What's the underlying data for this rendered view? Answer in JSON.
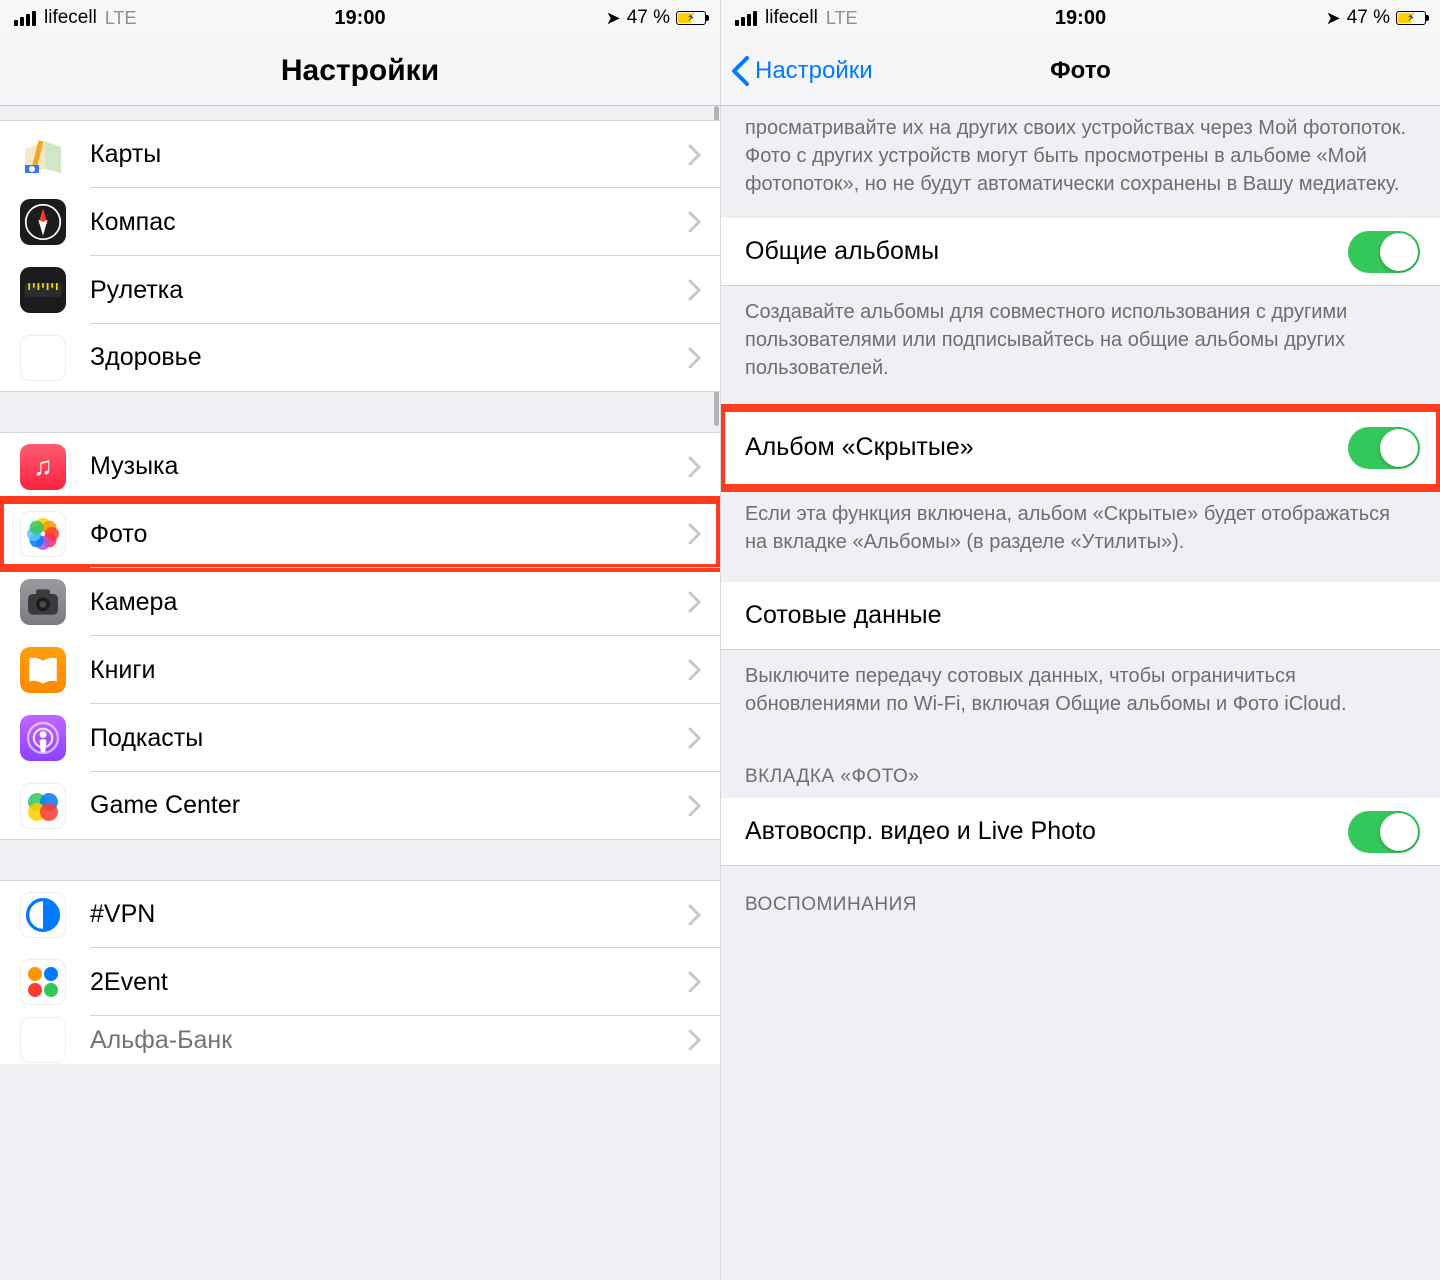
{
  "status": {
    "carrier": "lifecell",
    "network": "LTE",
    "time": "19:00",
    "battery_pct": "47 %",
    "location_glyph": "➤"
  },
  "left": {
    "title": "Настройки",
    "groups": [
      {
        "items": [
          {
            "key": "maps",
            "label": "Карты"
          },
          {
            "key": "compass",
            "label": "Компас"
          },
          {
            "key": "measure",
            "label": "Рулетка"
          },
          {
            "key": "health",
            "label": "Здоровье"
          }
        ]
      },
      {
        "items": [
          {
            "key": "music",
            "label": "Музыка"
          },
          {
            "key": "photos",
            "label": "Фото",
            "highlight": true
          },
          {
            "key": "camera",
            "label": "Камера"
          },
          {
            "key": "books",
            "label": "Книги"
          },
          {
            "key": "podcasts",
            "label": "Подкасты"
          },
          {
            "key": "gamecenter",
            "label": "Game Center"
          }
        ]
      },
      {
        "items": [
          {
            "key": "vpn",
            "label": "#VPN"
          },
          {
            "key": "2event",
            "label": "2Event"
          },
          {
            "key": "alpha",
            "label": "Альфа-Банк"
          }
        ]
      }
    ]
  },
  "right": {
    "back": "Настройки",
    "title": "Фото",
    "top_footer": "просматривайте их на других своих устройствах через Мой фотопоток. Фото с других устройств могут быть просмотрены в альбоме «Мой фотопоток», но не будут автоматически сохранены в Вашу медиатеку.",
    "shared_albums": {
      "label": "Общие альбомы",
      "on": true
    },
    "shared_footer": "Создавайте альбомы для совместного использования с другими пользователями или подписывайтесь на общие альбомы других пользователей.",
    "hidden": {
      "label": "Альбом «Скрытые»",
      "on": true,
      "highlight": true
    },
    "hidden_footer": "Если эта функция включена, альбом «Скрытые» будет отображаться на вкладке «Альбомы» (в разделе «Утилиты»).",
    "cellular": {
      "label": "Сотовые данные"
    },
    "cellular_footer": "Выключите передачу сотовых данных, чтобы ограничиться обновлениями по Wi-Fi, включая Общие альбомы и Фото iCloud.",
    "tab_header": "ВКЛАДКА «ФОТО»",
    "autoplay": {
      "label": "Автовоспр. видео и Live Photo",
      "on": true
    },
    "memories_header": "ВОСПОМИНАНИЯ"
  }
}
